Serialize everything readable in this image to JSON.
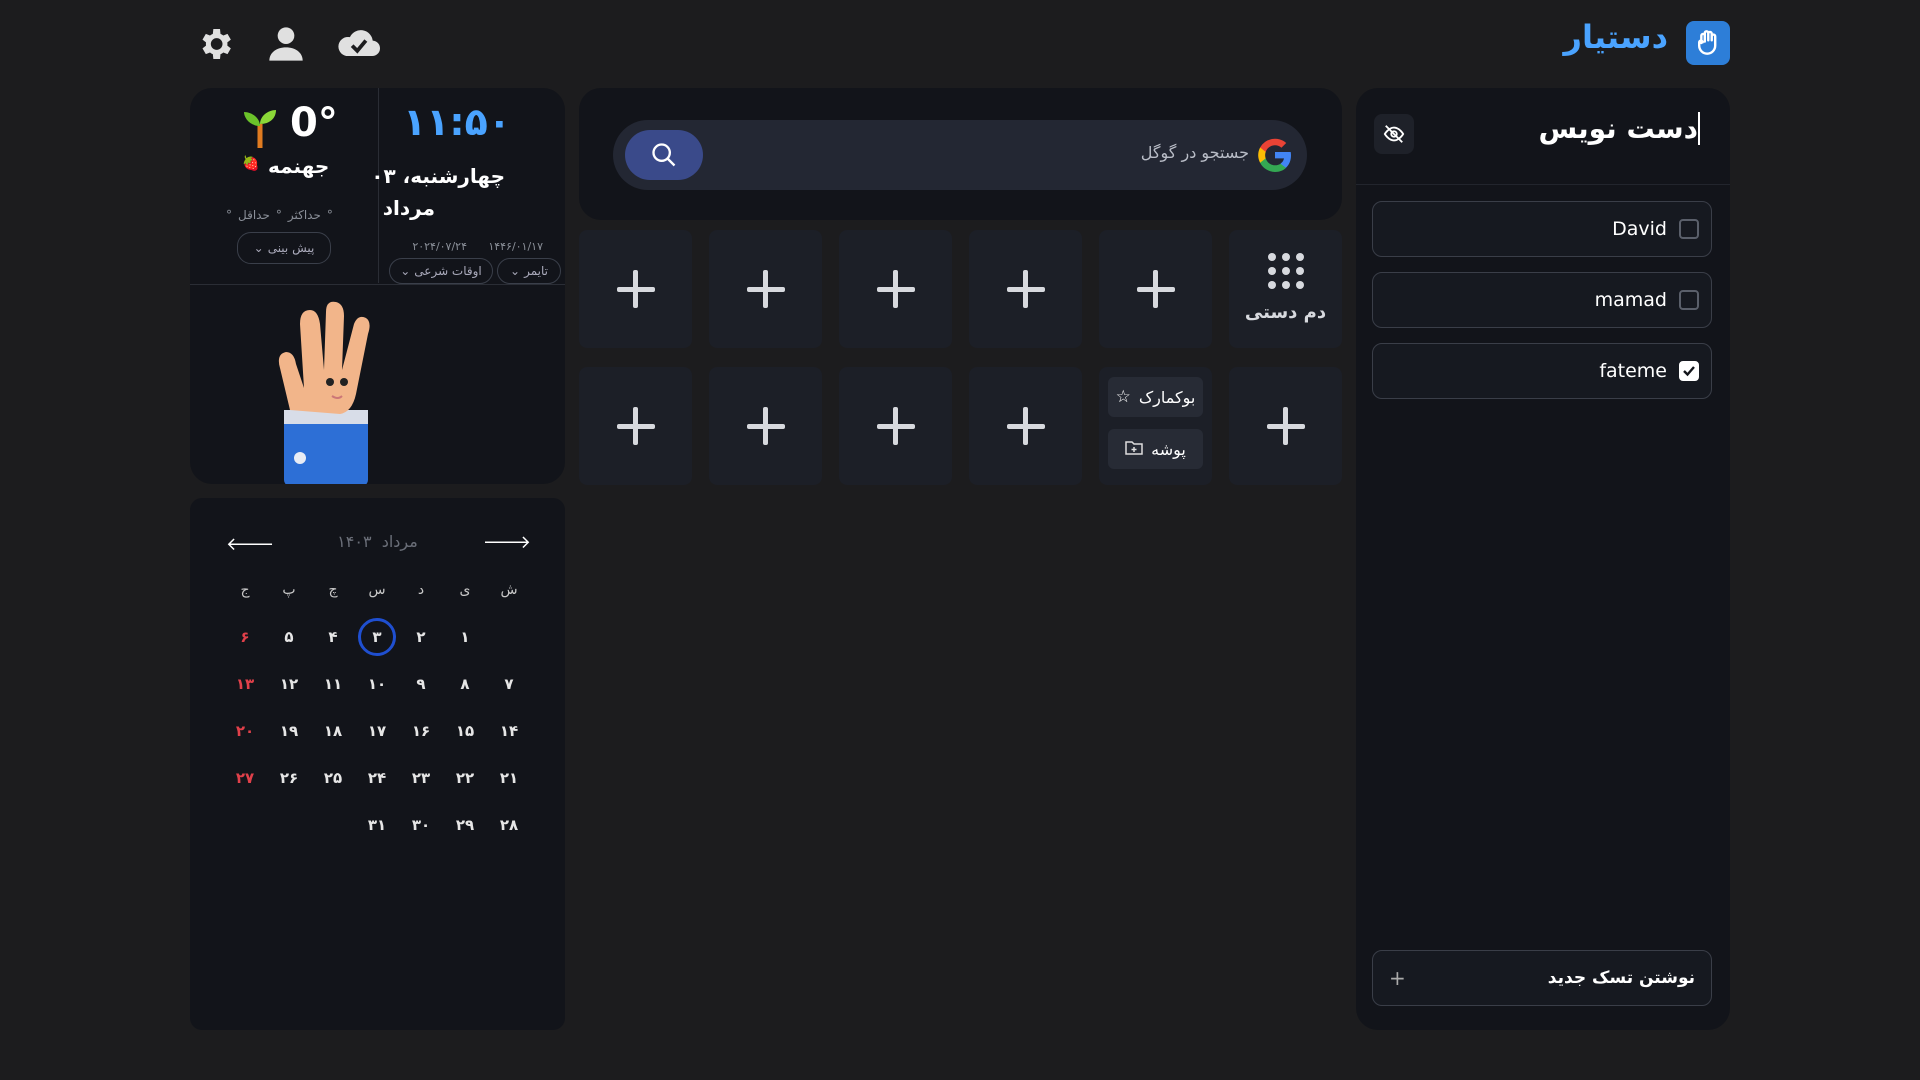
{
  "header": {
    "brand": "دستیار",
    "icons": [
      "settings-icon",
      "user-icon",
      "cloud-check-icon"
    ]
  },
  "clock_widget": {
    "time": "۱۱:۵۰",
    "day_date": "چهارشنبه، ۰۳",
    "month": "مرداد",
    "hijri_date": "۱۴۴۶/۰۱/۱۷",
    "gregorian_date": "۲۰۲۴/۰۷/۲۴",
    "timer_label": "تایمر",
    "prayer_label": "اوقات شرعی",
    "temperature": "0°",
    "city": "جهنمه",
    "max_label": "حداکثر",
    "min_label": "حداقل",
    "degree": "°",
    "forecast_label": "پیش بینی"
  },
  "search": {
    "placeholder": "جستجو در گوگل"
  },
  "shortcuts": {
    "app_label": "دم دستی",
    "bookmark_label": "بوکمارک",
    "folder_label": "پوشه"
  },
  "calendar": {
    "month": "مرداد",
    "year": "۱۴۰۳",
    "weekdays": [
      "ش",
      "ی",
      "د",
      "س",
      "چ",
      "پ",
      "ج"
    ],
    "days": [
      "",
      "",
      "",
      "",
      "",
      "",
      ""
    ],
    "today": "۳"
  },
  "notes": {
    "title": "دست نویس",
    "tasks": [
      {
        "label": "David",
        "checked": false
      },
      {
        "label": "mamad",
        "checked": false
      },
      {
        "label": "fateme",
        "checked": true
      }
    ],
    "new_task_label": "نوشتن تسک جدید"
  },
  "colors": {
    "accent": "#4aa3ff",
    "background": "#1c1c1e",
    "panel": "#12141a",
    "friday": "#e0404a",
    "today_ring": "#1f4fd0"
  }
}
